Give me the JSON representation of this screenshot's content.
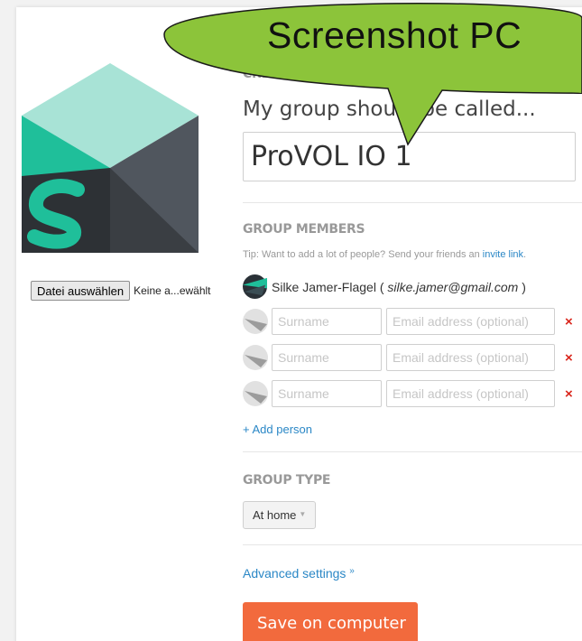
{
  "colors": {
    "accent_orange": "#f26a3d",
    "link_blue": "#2a87c6",
    "remove_red": "#d9261c",
    "callout_green": "#8cc43a"
  },
  "callout": {
    "text": "Screenshot PC"
  },
  "upload": {
    "button_label": "Datei auswählen",
    "status": "Keine a...ewählt"
  },
  "create": {
    "section_title": "CREATE A GROUP",
    "name_label": "My group should be called...",
    "name_value": "ProVOL IO 1"
  },
  "members": {
    "section_title": "GROUP MEMBERS",
    "tip_text": "Tip: Want to add a lot of people? Send your friends an ",
    "tip_link": "invite link",
    "tip_end": ".",
    "owner": {
      "name": "Silke Jamer-Flagel",
      "open": " ( ",
      "email": "silke.jamer@gmail.com",
      "close": " )"
    },
    "rows": [
      {
        "surname_placeholder": "Surname",
        "email_placeholder": "Email address (optional)",
        "remove": "×"
      },
      {
        "surname_placeholder": "Surname",
        "email_placeholder": "Email address (optional)",
        "remove": "×"
      },
      {
        "surname_placeholder": "Surname",
        "email_placeholder": "Email address (optional)",
        "remove": "×"
      }
    ],
    "add_person": "+ Add person"
  },
  "group_type": {
    "section_title": "GROUP TYPE",
    "selected": "At home"
  },
  "advanced": {
    "label": "Advanced settings",
    "icon": "»"
  },
  "save": {
    "label": "Save on computer"
  }
}
